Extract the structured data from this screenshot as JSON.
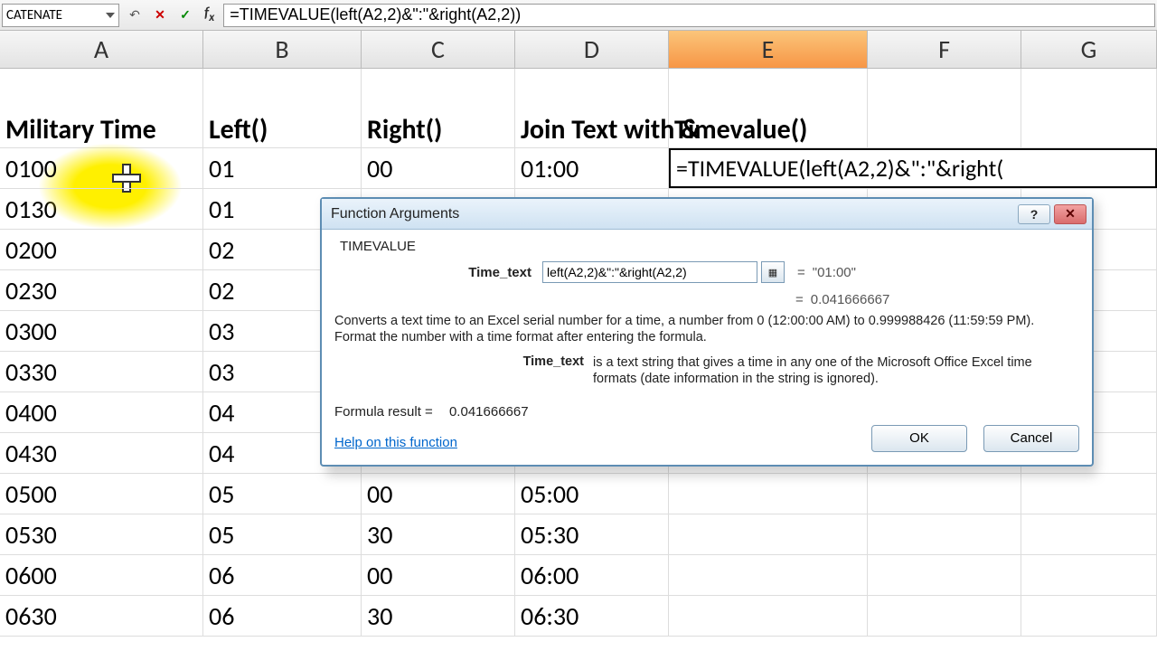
{
  "formula_bar": {
    "name_box": "CATENATE",
    "formula": "=TIMEVALUE(left(A2,2)&\":\"&right(A2,2))"
  },
  "columns": [
    "A",
    "B",
    "C",
    "D",
    "E",
    "F",
    "G"
  ],
  "selected_column": "E",
  "headers": {
    "A": "Military Time",
    "B": "Left()",
    "C": "Right()",
    "D": "Join Text with &",
    "E": "Timevalue()"
  },
  "formula_cell": "=TIMEVALUE(left(A2,2)&\":\"&right(",
  "rows": [
    {
      "A": "0100",
      "B": "01",
      "C": "00",
      "D": "01:00"
    },
    {
      "A": "0130",
      "B": "01",
      "C": "",
      "D": ""
    },
    {
      "A": "0200",
      "B": "02",
      "C": "",
      "D": ""
    },
    {
      "A": "0230",
      "B": "02",
      "C": "",
      "D": ""
    },
    {
      "A": "0300",
      "B": "03",
      "C": "",
      "D": ""
    },
    {
      "A": "0330",
      "B": "03",
      "C": "",
      "D": ""
    },
    {
      "A": "0400",
      "B": "04",
      "C": "",
      "D": ""
    },
    {
      "A": "0430",
      "B": "04",
      "C": "",
      "D": ""
    },
    {
      "A": "0500",
      "B": "05",
      "C": "00",
      "D": "05:00"
    },
    {
      "A": "0530",
      "B": "05",
      "C": "30",
      "D": "05:30"
    },
    {
      "A": "0600",
      "B": "06",
      "C": "00",
      "D": "06:00"
    },
    {
      "A": "0630",
      "B": "06",
      "C": "30",
      "D": "06:30"
    }
  ],
  "dialog": {
    "title": "Function Arguments",
    "function_name": "TIMEVALUE",
    "arg_label": "Time_text",
    "arg_input": "left(A2,2)&\":\"&right(A2,2)",
    "arg_value_text": "\"01:00\"",
    "result_value": "0.041666667",
    "description": "Converts a text time to an Excel serial number for a time, a number from 0 (12:00:00 AM) to 0.999988426 (11:59:59 PM). Format the number with a time format after entering the formula.",
    "param_label": "Time_text",
    "param_desc": "is a text string that gives a time in any one of the Microsoft Office Excel time formats (date information in the string is ignored).",
    "formula_result_label": "Formula result =",
    "formula_result_value": "0.041666667",
    "help_link": "Help on this function",
    "ok": "OK",
    "cancel": "Cancel"
  }
}
